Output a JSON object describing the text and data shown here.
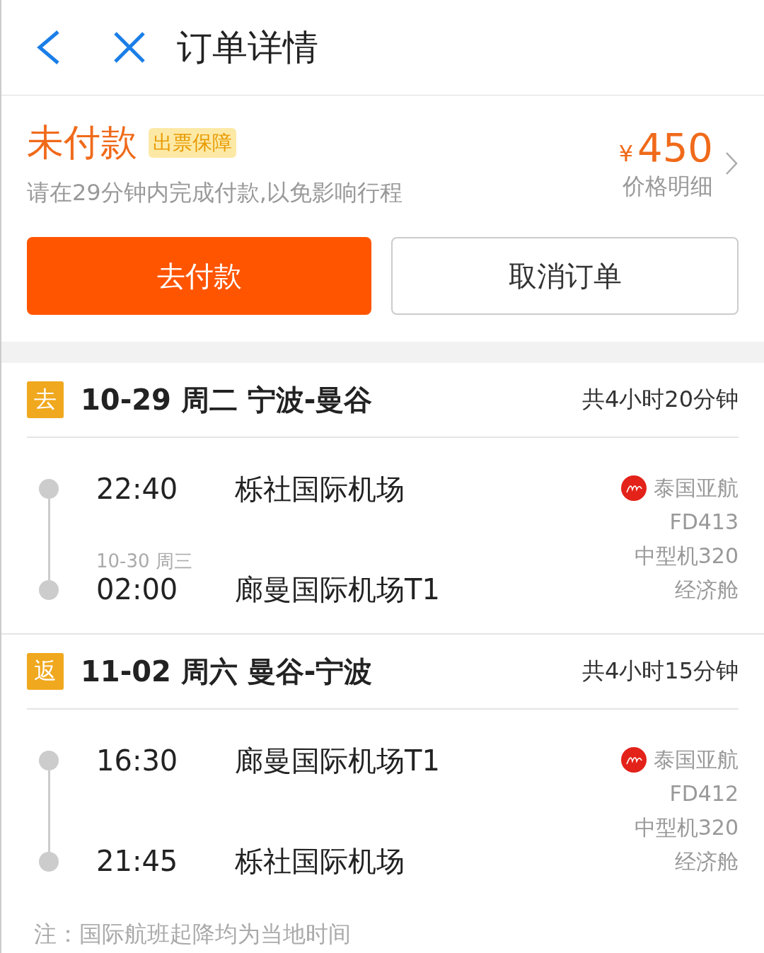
{
  "header": {
    "title": "订单详情"
  },
  "status": {
    "title": "未付款",
    "badge": "出票保障",
    "hint": "请在29分钟内完成付款,以免影响行程",
    "currency": "¥",
    "price": "450",
    "price_link": "价格明细"
  },
  "actions": [
    {
      "label": "去付款",
      "kind": "primary"
    },
    {
      "label": "取消订单",
      "kind": "secondary"
    }
  ],
  "segments": [
    {
      "tag": "去",
      "title": "10-29 周二 宁波-曼谷",
      "duration": "共4小时20分钟",
      "depart": {
        "time": "22:40",
        "airport": "栎社国际机场"
      },
      "arrive": {
        "date": "10-30 周三",
        "time": "02:00",
        "airport": "廊曼国际机场T1"
      },
      "airline": "泰国亚航",
      "flight": "FD413",
      "aircraft": "中型机320",
      "cabin": "经济舱"
    },
    {
      "tag": "返",
      "title": "11-02 周六 曼谷-宁波",
      "duration": "共4小时15分钟",
      "depart": {
        "time": "16:30",
        "airport": "廊曼国际机场T1"
      },
      "arrive": {
        "time": "21:45",
        "airport": "栎社国际机场"
      },
      "airline": "泰国亚航",
      "flight": "FD412",
      "aircraft": "中型机320",
      "cabin": "经济舱"
    }
  ],
  "note": "注：国际航班起降均为当地时间"
}
